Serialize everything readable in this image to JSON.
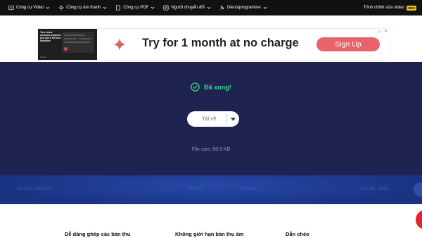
{
  "nav": {
    "items": [
      {
        "label": "Công cụ Video",
        "icon": "video-play-icon"
      },
      {
        "label": "Công cụ âm thanh",
        "icon": "audio-settings-icon"
      },
      {
        "label": "Công cụ PDF",
        "icon": "pdf-document-icon"
      },
      {
        "label": "Người chuyển đổi",
        "icon": "converter-icon"
      },
      {
        "label": "Dienstprogramme",
        "icon": "tools-icon"
      }
    ],
    "right_label": "Trình chỉnh sửa video",
    "new_badge": "NEW"
  },
  "ad": {
    "thumb_text": "Your most complex projects just got a lot less complex",
    "thumb_footer": "Canva",
    "headline": "Try for 1 month at no charge",
    "cta": "Sign Up",
    "choice_icon": "adchoices-icon",
    "close_icon": "close-icon"
  },
  "result": {
    "status": "Đã xong!",
    "download_label": "Tải Về",
    "file_size": "File size: 58.9 KB"
  },
  "stats": {
    "left": "00:00:0 / 00:00:0",
    "mid1": "00:00:0",
    "mid2": "00:00:0",
    "right": "Tốc độ: 100%"
  },
  "features": {
    "f1": "Dễ dàng ghép các bản thu",
    "f2": "Không giới hạn bản thu âm",
    "f3": "Dẫn chéo"
  },
  "colors": {
    "nav_bg": "#111111",
    "main_bg": "#1f2350",
    "success": "#3ddc8f",
    "cta": "#e8636b",
    "stats_bg": "#1a3484",
    "badge": "#f5c518"
  }
}
